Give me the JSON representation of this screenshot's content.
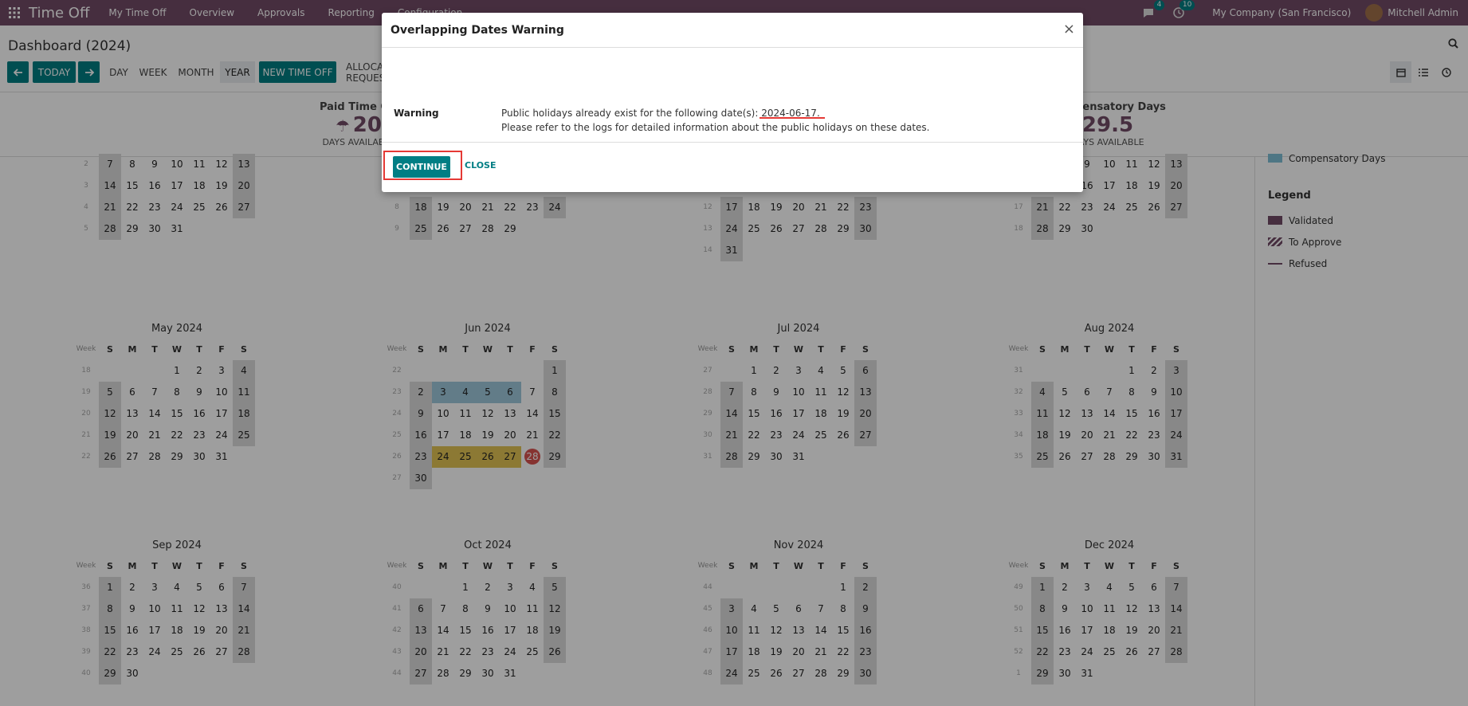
{
  "navbar": {
    "brand": "Time Off",
    "items": [
      "My Time Off",
      "Overview",
      "Approvals",
      "Reporting",
      "Configuration"
    ],
    "messages_count": "4",
    "activities_count": "10",
    "company": "My Company (San Francisco)",
    "user": "Mitchell Admin"
  },
  "control": {
    "title": "Dashboard (2024)",
    "today_label": "TODAY",
    "day_label": "DAY",
    "week_label": "WEEK",
    "month_label": "MONTH",
    "year_label": "YEAR",
    "new_label": "NEW TIME OFF",
    "alloc_label": "ALLOCATION REQUEST"
  },
  "summary": {
    "left_title": "Paid Time Off",
    "left_value": "20",
    "left_sub": "DAYS AVAILABLE",
    "right_title": "Compensatory Days",
    "right_value": "29.5",
    "right_sub": "DAYS AVAILABLE"
  },
  "weekday_headers": [
    "S",
    "M",
    "T",
    "W",
    "T",
    "F",
    "S"
  ],
  "week_label": "Week",
  "top_partial": [
    {
      "rows": [
        {
          "wk": "2",
          "days": [
            "",
            "7",
            "8",
            "9",
            "10",
            "11",
            "12",
            "13"
          ]
        },
        {
          "wk": "3",
          "days": [
            "",
            "14",
            "15",
            "16",
            "17",
            "18",
            "19",
            "20"
          ]
        },
        {
          "wk": "4",
          "days": [
            "",
            "21",
            "22",
            "23",
            "24",
            "25",
            "26",
            "27"
          ]
        },
        {
          "wk": "5",
          "days": [
            "",
            "28",
            "29",
            "30",
            "31",
            "",
            "",
            ""
          ]
        }
      ]
    },
    {
      "rows": [
        {
          "wk": "",
          "days": [
            "",
            "",
            "",
            "",
            "",
            "",
            "",
            ""
          ]
        },
        {
          "wk": "",
          "days": [
            "",
            "",
            "",
            "",
            "",
            "",
            "",
            ""
          ]
        },
        {
          "wk": "8",
          "days": [
            "",
            "18",
            "19",
            "20",
            "21",
            "22",
            "23",
            "24"
          ]
        },
        {
          "wk": "9",
          "days": [
            "",
            "25",
            "26",
            "27",
            "28",
            "29",
            "",
            ""
          ]
        }
      ]
    },
    {
      "rows": [
        {
          "wk": "",
          "days": [
            "",
            "",
            "",
            "",
            "",
            "",
            "",
            ""
          ]
        },
        {
          "wk": "",
          "days": [
            "",
            "",
            "",
            "",
            "",
            "",
            "",
            ""
          ]
        },
        {
          "wk": "12",
          "days": [
            "",
            "17",
            "18",
            "19",
            "20",
            "21",
            "22",
            "23"
          ]
        },
        {
          "wk": "13",
          "days": [
            "",
            "24",
            "25",
            "26",
            "27",
            "28",
            "29",
            "30"
          ]
        },
        {
          "wk": "14",
          "days": [
            "",
            "31",
            "",
            "",
            "",
            "",
            "",
            ""
          ]
        }
      ]
    },
    {
      "rows": [
        {
          "wk": "",
          "days": [
            "",
            "",
            "",
            "9",
            "10",
            "11",
            "12",
            "13"
          ]
        },
        {
          "wk": "",
          "days": [
            "",
            "",
            "",
            "16",
            "17",
            "18",
            "19",
            "20"
          ]
        },
        {
          "wk": "17",
          "days": [
            "",
            "21",
            "22",
            "23",
            "24",
            "25",
            "26",
            "27"
          ]
        },
        {
          "wk": "18",
          "days": [
            "",
            "28",
            "29",
            "30",
            "",
            "",
            "",
            ""
          ]
        }
      ]
    }
  ],
  "months": [
    {
      "title": "May 2024",
      "rows": [
        {
          "wk": "18",
          "days": [
            "",
            "",
            "",
            "1",
            "2",
            "3",
            "4"
          ]
        },
        {
          "wk": "19",
          "days": [
            "5",
            "6",
            "7",
            "8",
            "9",
            "10",
            "11"
          ]
        },
        {
          "wk": "20",
          "days": [
            "12",
            "13",
            "14",
            "15",
            "16",
            "17",
            "18"
          ]
        },
        {
          "wk": "21",
          "days": [
            "19",
            "20",
            "21",
            "22",
            "23",
            "24",
            "25"
          ]
        },
        {
          "wk": "22",
          "days": [
            "26",
            "27",
            "28",
            "29",
            "30",
            "31",
            ""
          ]
        }
      ]
    },
    {
      "title": "Jun 2024",
      "rows": [
        {
          "wk": "22",
          "days": [
            "",
            "",
            "",
            "",
            "",
            "",
            "1"
          ]
        },
        {
          "wk": "23",
          "days": [
            "2",
            "3",
            "4",
            "5",
            "6",
            "7",
            "8"
          ]
        },
        {
          "wk": "24",
          "days": [
            "9",
            "10",
            "11",
            "12",
            "13",
            "14",
            "15"
          ]
        },
        {
          "wk": "25",
          "days": [
            "16",
            "17",
            "18",
            "19",
            "20",
            "21",
            "22"
          ]
        },
        {
          "wk": "26",
          "days": [
            "23",
            "24",
            "25",
            "26",
            "27",
            "28",
            "29"
          ]
        },
        {
          "wk": "27",
          "days": [
            "30",
            "",
            "",
            "",
            "",
            "",
            ""
          ]
        }
      ]
    },
    {
      "title": "Jul 2024",
      "rows": [
        {
          "wk": "27",
          "days": [
            "",
            "1",
            "2",
            "3",
            "4",
            "5",
            "6"
          ]
        },
        {
          "wk": "28",
          "days": [
            "7",
            "8",
            "9",
            "10",
            "11",
            "12",
            "13"
          ]
        },
        {
          "wk": "29",
          "days": [
            "14",
            "15",
            "16",
            "17",
            "18",
            "19",
            "20"
          ]
        },
        {
          "wk": "30",
          "days": [
            "21",
            "22",
            "23",
            "24",
            "25",
            "26",
            "27"
          ]
        },
        {
          "wk": "31",
          "days": [
            "28",
            "29",
            "30",
            "31",
            "",
            "",
            ""
          ]
        }
      ]
    },
    {
      "title": "Aug 2024",
      "rows": [
        {
          "wk": "31",
          "days": [
            "",
            "",
            "",
            "",
            "1",
            "2",
            "3"
          ]
        },
        {
          "wk": "32",
          "days": [
            "4",
            "5",
            "6",
            "7",
            "8",
            "9",
            "10"
          ]
        },
        {
          "wk": "33",
          "days": [
            "11",
            "12",
            "13",
            "14",
            "15",
            "16",
            "17"
          ]
        },
        {
          "wk": "34",
          "days": [
            "18",
            "19",
            "20",
            "21",
            "22",
            "23",
            "24"
          ]
        },
        {
          "wk": "35",
          "days": [
            "25",
            "26",
            "27",
            "28",
            "29",
            "30",
            "31"
          ]
        }
      ]
    },
    {
      "title": "Sep 2024",
      "rows": [
        {
          "wk": "36",
          "days": [
            "1",
            "2",
            "3",
            "4",
            "5",
            "6",
            "7"
          ]
        },
        {
          "wk": "37",
          "days": [
            "8",
            "9",
            "10",
            "11",
            "12",
            "13",
            "14"
          ]
        },
        {
          "wk": "38",
          "days": [
            "15",
            "16",
            "17",
            "18",
            "19",
            "20",
            "21"
          ]
        },
        {
          "wk": "39",
          "days": [
            "22",
            "23",
            "24",
            "25",
            "26",
            "27",
            "28"
          ]
        },
        {
          "wk": "40",
          "days": [
            "29",
            "30",
            "",
            "",
            "",
            "",
            ""
          ]
        }
      ]
    },
    {
      "title": "Oct 2024",
      "rows": [
        {
          "wk": "40",
          "days": [
            "",
            "",
            "1",
            "2",
            "3",
            "4",
            "5"
          ]
        },
        {
          "wk": "41",
          "days": [
            "6",
            "7",
            "8",
            "9",
            "10",
            "11",
            "12"
          ]
        },
        {
          "wk": "42",
          "days": [
            "13",
            "14",
            "15",
            "16",
            "17",
            "18",
            "19"
          ]
        },
        {
          "wk": "43",
          "days": [
            "20",
            "21",
            "22",
            "23",
            "24",
            "25",
            "26"
          ]
        },
        {
          "wk": "44",
          "days": [
            "27",
            "28",
            "29",
            "30",
            "31",
            "",
            ""
          ]
        }
      ]
    },
    {
      "title": "Nov 2024",
      "rows": [
        {
          "wk": "44",
          "days": [
            "",
            "",
            "",
            "",
            "",
            "1",
            "2"
          ]
        },
        {
          "wk": "45",
          "days": [
            "3",
            "4",
            "5",
            "6",
            "7",
            "8",
            "9"
          ]
        },
        {
          "wk": "46",
          "days": [
            "10",
            "11",
            "12",
            "13",
            "14",
            "15",
            "16"
          ]
        },
        {
          "wk": "47",
          "days": [
            "17",
            "18",
            "19",
            "20",
            "21",
            "22",
            "23"
          ]
        },
        {
          "wk": "48",
          "days": [
            "24",
            "25",
            "26",
            "27",
            "28",
            "29",
            "30"
          ]
        }
      ]
    },
    {
      "title": "Dec 2024",
      "rows": [
        {
          "wk": "49",
          "days": [
            "1",
            "2",
            "3",
            "4",
            "5",
            "6",
            "7"
          ]
        },
        {
          "wk": "50",
          "days": [
            "8",
            "9",
            "10",
            "11",
            "12",
            "13",
            "14"
          ]
        },
        {
          "wk": "51",
          "days": [
            "15",
            "16",
            "17",
            "18",
            "19",
            "20",
            "21"
          ]
        },
        {
          "wk": "52",
          "days": [
            "22",
            "23",
            "24",
            "25",
            "26",
            "27",
            "28"
          ]
        },
        {
          "wk": "1",
          "days": [
            "29",
            "30",
            "31",
            "",
            "",
            "",
            ""
          ]
        }
      ]
    }
  ],
  "holiday_days_jun": [
    "3",
    "4",
    "5",
    "6"
  ],
  "pending_days_jun": [
    "24",
    "25",
    "26",
    "27"
  ],
  "today_jun": "28",
  "legend": {
    "partial_item": "Compensatory Days",
    "title": "Legend",
    "items": [
      {
        "label": "Validated",
        "color": "#714b67"
      },
      {
        "label": "To Approve",
        "color": "#714b67"
      },
      {
        "label": "Refused",
        "color": "#714b67"
      }
    ]
  },
  "modal": {
    "title": "Overlapping Dates Warning",
    "close_glyph": "×",
    "label": "Warning",
    "line1_prefix": "Public holidays already exist for the following date(s): ",
    "line1_date": "2024-06-17.",
    "line2": "Please refer to the logs for detailed information about the public holidays on these dates.",
    "continue_label": "CONTINUE",
    "close_label": "CLOSE"
  },
  "colors": {
    "brand": "#714b67",
    "accent": "#017e84",
    "highlight": "#e53935"
  }
}
